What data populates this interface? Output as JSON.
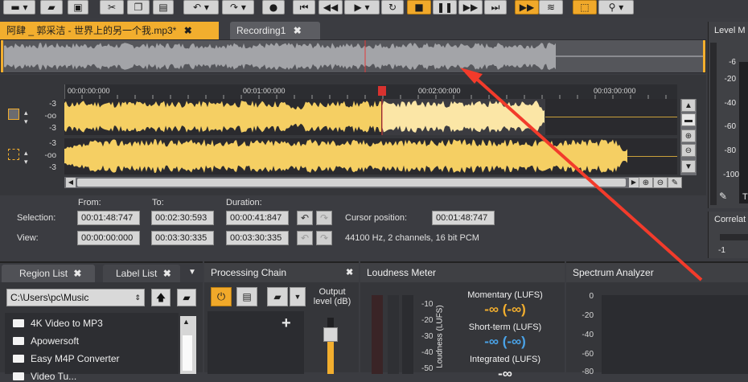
{
  "toolbar": {
    "buttons": [
      {
        "name": "new-file-button",
        "glyph": "▬ ▾"
      },
      {
        "name": "open-file-button",
        "glyph": "▰"
      },
      {
        "name": "save-button",
        "glyph": "▣"
      },
      {
        "name": "cut-button",
        "glyph": "✂"
      },
      {
        "name": "copy-button",
        "glyph": "❐"
      },
      {
        "name": "paste-button",
        "glyph": "▤"
      },
      {
        "name": "undo-button",
        "glyph": "↶ ▾"
      },
      {
        "name": "redo-button",
        "glyph": "↷ ▾"
      },
      {
        "name": "record-button",
        "glyph": "●"
      },
      {
        "name": "go-to-start-button",
        "glyph": "⏮"
      },
      {
        "name": "rewind-button",
        "glyph": "◀◀"
      },
      {
        "name": "play-button",
        "glyph": "▶ ▾"
      },
      {
        "name": "loop-button",
        "glyph": "↻"
      },
      {
        "name": "stop-button",
        "glyph": "■"
      },
      {
        "name": "pause-button",
        "glyph": "❚❚"
      },
      {
        "name": "fast-forward-button",
        "glyph": "▶▶"
      },
      {
        "name": "go-to-end-button",
        "glyph": "⏭"
      },
      {
        "name": "play-selection-button",
        "glyph": "▶▶"
      },
      {
        "name": "waveform-view-button",
        "glyph": "≋"
      },
      {
        "name": "select-tool-button",
        "glyph": "⬚"
      },
      {
        "name": "zoom-tool-button",
        "glyph": "⚲ ▾"
      }
    ]
  },
  "tabs": [
    {
      "label": "阿肆 _ 郭采洁 - 世界上的另一个我.mp3*",
      "close": "✖"
    },
    {
      "label": "Recording1",
      "close": "✖"
    }
  ],
  "ruler": {
    "ticks": [
      "00:00:00:000",
      "00:01:00:000",
      "00:02:00:000",
      "00:03:00:000"
    ]
  },
  "tracks": {
    "db_labels": [
      "-3",
      "-oo",
      "-3"
    ]
  },
  "selection_info": {
    "from_label": "From:",
    "to_label": "To:",
    "duration_label": "Duration:",
    "selection_label": "Selection:",
    "view_label": "View:",
    "selection_from": "00:01:48:747",
    "selection_to": "00:02:30:593",
    "selection_duration": "00:00:41:847",
    "view_from": "00:00:00:000",
    "view_to": "00:03:30:335",
    "view_duration": "00:03:30:335",
    "cursor_label": "Cursor position:",
    "cursor_value": "00:01:48:747",
    "format": "44100 Hz, 2 channels, 16 bit PCM"
  },
  "level_panel": {
    "title": "Level M",
    "scale": [
      "-6",
      "-20",
      "-40",
      "-60",
      "-80",
      "-100"
    ],
    "footer": "T"
  },
  "correl_panel": {
    "title": "Correlat",
    "value": "-1"
  },
  "region_panel": {
    "tab1": "Region List",
    "tab2": "Label List",
    "path": "C:\\Users\\pc\\Music",
    "items": [
      "4K Video to MP3",
      "Apowersoft",
      "Easy M4P Converter",
      "Video Tu..."
    ]
  },
  "processing_panel": {
    "title": "Processing Chain",
    "output_label": "Output level (dB)",
    "add": "+"
  },
  "loudness_panel": {
    "title": "Loudness Meter",
    "axis_label": "Loudness (LUFS)",
    "scale": [
      "-10",
      "-20",
      "-30",
      "-40",
      "-50"
    ],
    "momentary_label": "Momentary (LUFS)",
    "momentary_value": "-∞ (-∞)",
    "shortterm_label": "Short-term (LUFS)",
    "shortterm_value": "-∞ (-∞)",
    "integrated_label": "Integrated (LUFS)",
    "integrated_value": "-∞"
  },
  "spectrum_panel": {
    "title": "Spectrum Analyzer",
    "scale": [
      "0",
      "-20",
      "-40",
      "-60",
      "-80"
    ]
  },
  "colors": {
    "accent": "#f2ae2e",
    "wave": "#f5cf63",
    "wave_selected": "#fbe6a6",
    "momentary": "#f2ae2e",
    "shortterm": "#4aa3e8",
    "annotation_arrow": "#f23b2b"
  }
}
